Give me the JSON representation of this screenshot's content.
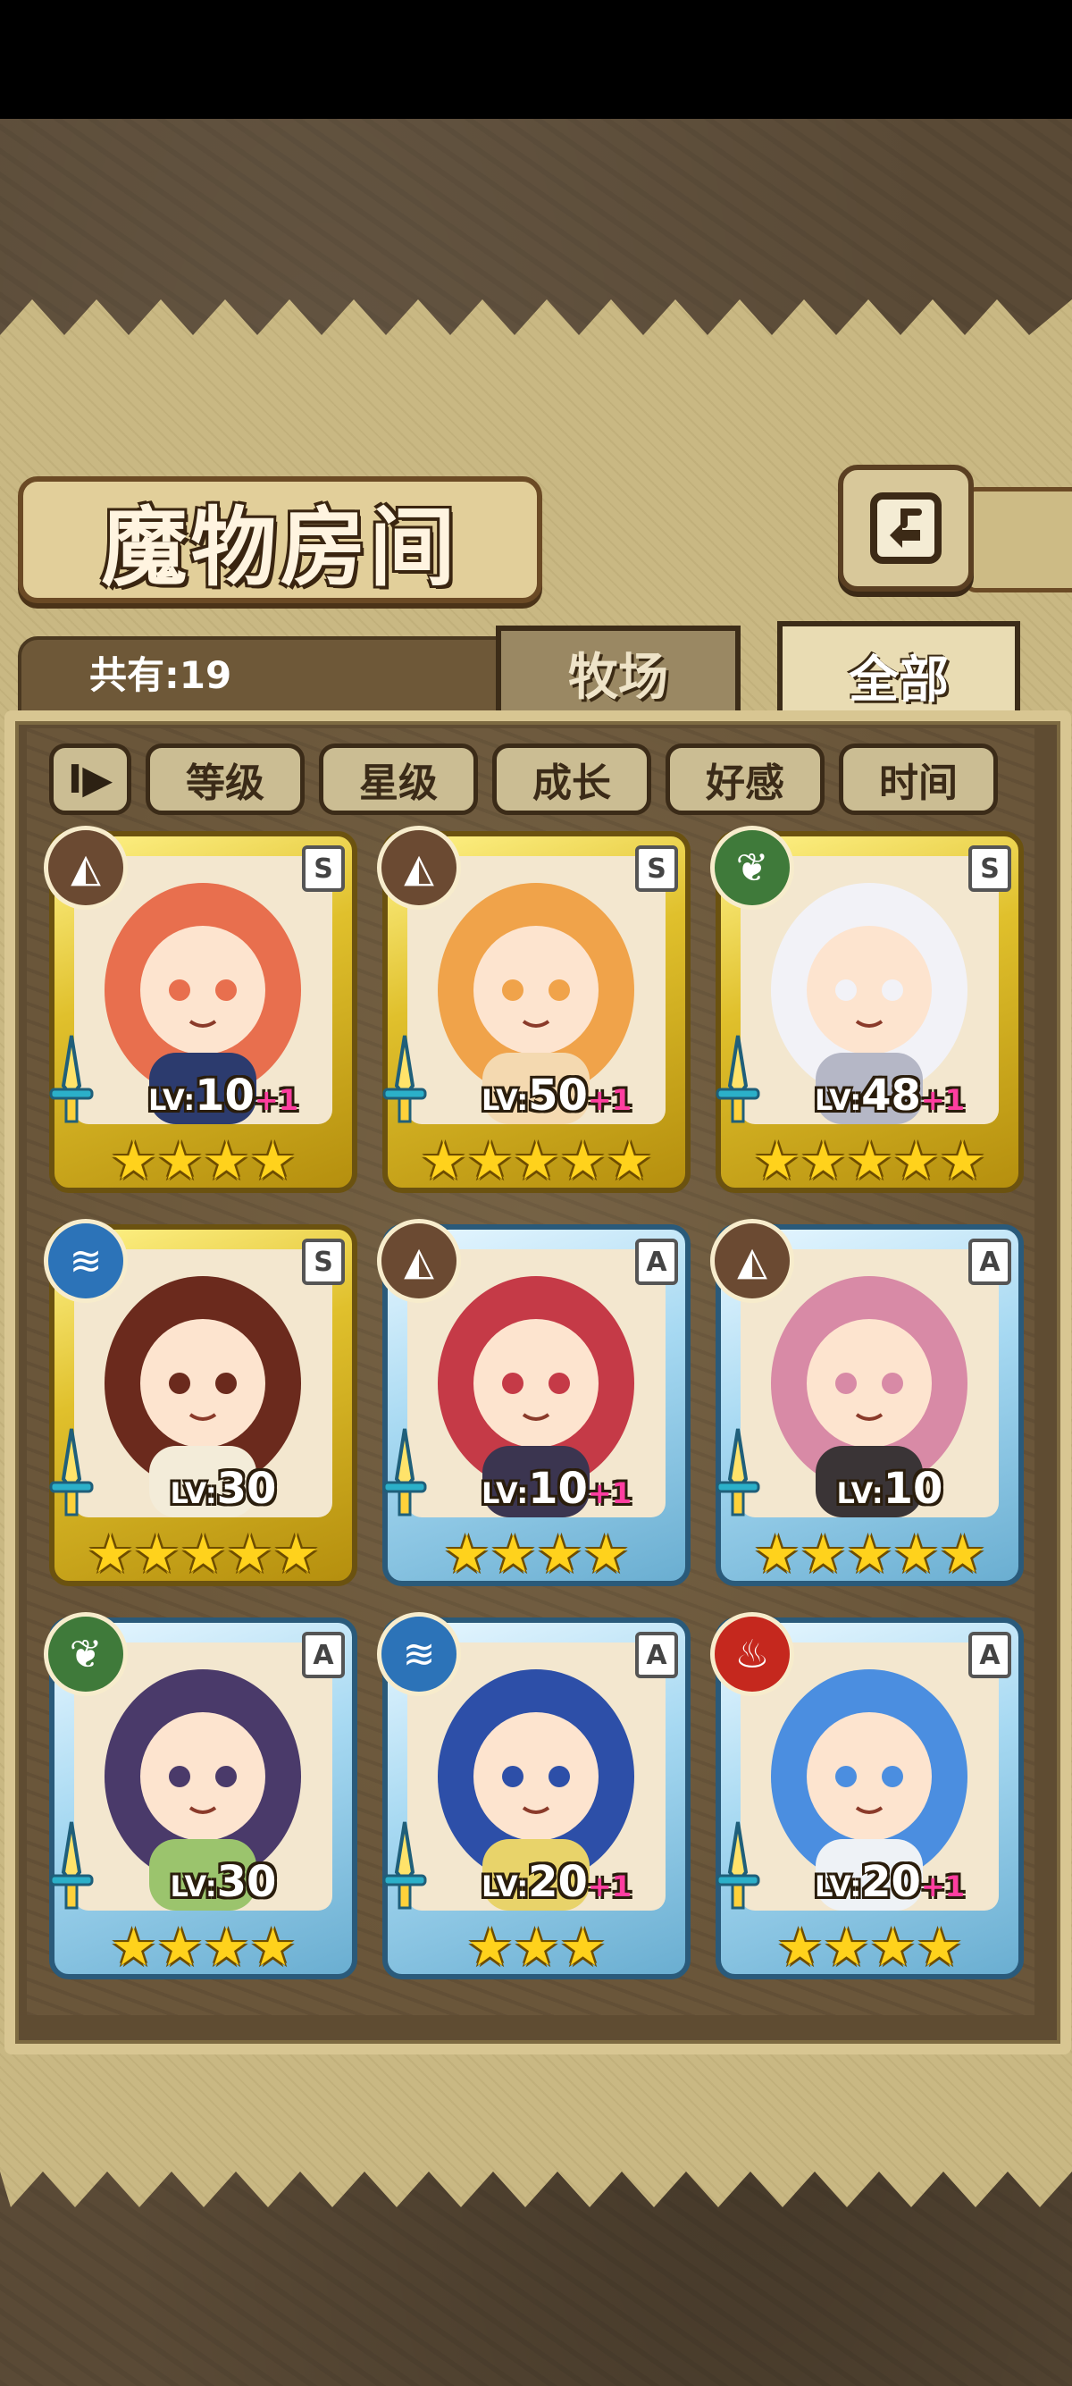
{
  "title": "魔物房间",
  "count_label": "共有:19",
  "tabs": {
    "farm": "牧场",
    "all": "全部"
  },
  "sort": {
    "toggle_symbol": "I▶",
    "buttons": [
      "等级",
      "星级",
      "成长",
      "好感",
      "时间"
    ]
  },
  "monsters": [
    {
      "rank": "S",
      "element": "earth",
      "level_prefix": "LV:",
      "level": "10",
      "plus": "+1",
      "stars": "★★★★",
      "frame": "gold",
      "hair": "#e86f4e",
      "accent": "#2c3b6e"
    },
    {
      "rank": "S",
      "element": "earth",
      "level_prefix": "LV:",
      "level": "50",
      "plus": "+1",
      "stars": "★★★★★",
      "frame": "gold",
      "hair": "#f0a34a",
      "accent": "#f4d9b0"
    },
    {
      "rank": "S",
      "element": "wind",
      "level_prefix": "LV:",
      "level": "48",
      "plus": "+1",
      "stars": "★★★★★",
      "frame": "gold",
      "hair": "#f2f2f7",
      "accent": "#b5b7c6"
    },
    {
      "rank": "S",
      "element": "water",
      "level_prefix": "LV:",
      "level": "30",
      "plus": "",
      "stars": "★★★★★",
      "frame": "gold",
      "hair": "#6b2a1d",
      "accent": "#f3ecd9"
    },
    {
      "rank": "A",
      "element": "earth",
      "level_prefix": "LV:",
      "level": "10",
      "plus": "+1",
      "stars": "★★★★",
      "frame": "blue",
      "hair": "#c53a47",
      "accent": "#3b3550"
    },
    {
      "rank": "A",
      "element": "earth",
      "level_prefix": "LV:",
      "level": "10",
      "plus": "",
      "stars": "★★★★★",
      "frame": "blue",
      "hair": "#d88aa6",
      "accent": "#3a3436"
    },
    {
      "rank": "A",
      "element": "wind",
      "level_prefix": "LV:",
      "level": "30",
      "plus": "",
      "stars": "★★★★",
      "frame": "blue",
      "hair": "#4a3a6a",
      "accent": "#9bc46d"
    },
    {
      "rank": "A",
      "element": "water",
      "level_prefix": "LV:",
      "level": "20",
      "plus": "+1",
      "stars": "★★★",
      "frame": "blue",
      "hair": "#2d4fa8",
      "accent": "#e8d36a"
    },
    {
      "rank": "A",
      "element": "fire",
      "level_prefix": "LV:",
      "level": "20",
      "plus": "+1",
      "stars": "★★★★",
      "frame": "blue",
      "hair": "#4b8ee0",
      "accent": "#eef2f6"
    }
  ],
  "element_icons": {
    "earth": {
      "symbol": "◭",
      "color": "#6b4a32"
    },
    "wind": {
      "symbol": "❦",
      "color": "#3f7a3a"
    },
    "water": {
      "symbol": "≋",
      "color": "#2c73b8"
    },
    "fire": {
      "symbol": "♨",
      "color": "#c5281e"
    }
  },
  "colors": {
    "panel": "#c9b883",
    "frame": "#d8c692",
    "star": "#ffd21c",
    "plus": "#ff3ea0"
  }
}
